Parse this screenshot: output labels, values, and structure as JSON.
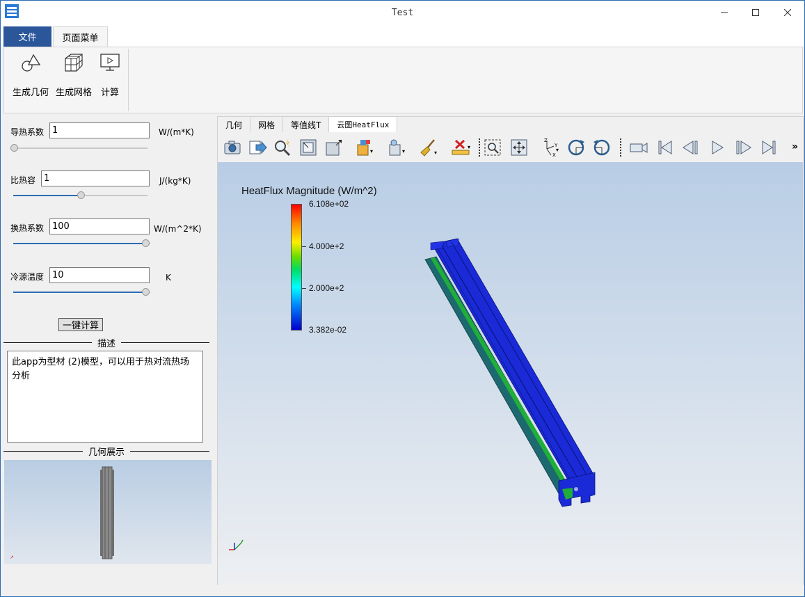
{
  "window": {
    "title": "Test"
  },
  "ribbon": {
    "tabs": [
      {
        "label": "文件"
      },
      {
        "label": "页面菜单"
      }
    ],
    "buttons": [
      {
        "label": "生成几何",
        "icon": "geometry-icon"
      },
      {
        "label": "生成网格",
        "icon": "mesh-icon"
      },
      {
        "label": "计算",
        "icon": "compute-icon"
      }
    ]
  },
  "params": [
    {
      "label": "导热系数",
      "value": "1",
      "unit": "W/(m*K)",
      "slider": 0.0
    },
    {
      "label": "比热容",
      "value": "1",
      "unit": "J/(kg*K)",
      "slider": 0.5
    },
    {
      "label": "换热系数",
      "value": "100",
      "unit": "W/(m^2*K)",
      "slider": 1.0
    },
    {
      "label": "冷源温度",
      "value": "10",
      "unit": "K",
      "slider": 1.0
    }
  ],
  "calc_button": "一键计算",
  "description": {
    "title": "描述",
    "text": "此app为型材 (2)模型，可以用于热对流热场分析"
  },
  "geometry_view": {
    "title": "几何展示"
  },
  "view_tabs": [
    "几何",
    "网格",
    "等值线T",
    "云图HeatFlux"
  ],
  "legend": {
    "title": "HeatFlux Magnitude (W/m^2)",
    "labels": [
      "6.108e+02",
      "4.000e+2",
      "2.000e+2",
      "3.382e-02"
    ]
  },
  "colors": {
    "accent": "#2b579a",
    "model_blue": "#1a2ad6"
  }
}
